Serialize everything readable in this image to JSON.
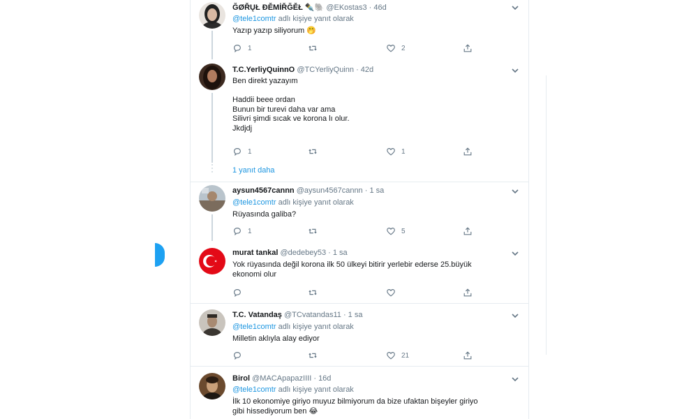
{
  "reply_to_label": "adlı kişiye yanıt olarak",
  "more_replies": "1 yanıt daha",
  "tweets": [
    {
      "name": "ĞØŘŲŁ ĐĚΜİŘĞĚŁ ✒️🐘",
      "handle": "@EKostas3",
      "time": "· 46d",
      "reply_to": "@tele1comtr",
      "text": [
        "Yazıp yazıp siliyorum 🤭"
      ],
      "reply_count": "1",
      "retweet_count": "",
      "like_count": "2"
    },
    {
      "name": "T.C.YerliyQuinnO",
      "handle": "@TCYerliyQuinn",
      "time": "· 42d",
      "reply_to": "",
      "text": [
        "Ben direkt yazayım",
        "",
        "Haddii beee ordan",
        "Bunun bir turevi daha var ama",
        "Silivri şimdi  sıcak  ve korona lı olur.",
        "Jkdjdj"
      ],
      "reply_count": "1",
      "retweet_count": "",
      "like_count": "1"
    },
    {
      "name": "aysun4567cannn",
      "handle": "@aysun4567cannn",
      "time": "· 1 sa",
      "reply_to": "@tele1comtr",
      "text": [
        "Rüyasında galiba?"
      ],
      "reply_count": "1",
      "retweet_count": "",
      "like_count": "5"
    },
    {
      "name": "murat tankal",
      "handle": "@dedebey53",
      "time": "· 1 sa",
      "reply_to": "",
      "text": [
        "Yok rüyasında değil korona ilk 50 ülkeyi bitirir yerlebir ederse 25.büyük",
        "ekonomi olur"
      ],
      "reply_count": "",
      "retweet_count": "",
      "like_count": ""
    },
    {
      "name": "T.C. Vatandaş",
      "handle": "@TCvatandas11",
      "time": "· 1 sa",
      "reply_to": "@tele1comtr",
      "text": [
        "Milletin aklıyla alay ediyor"
      ],
      "reply_count": "",
      "retweet_count": "",
      "like_count": "21"
    },
    {
      "name": "Birol",
      "handle": "@MACApapazIIII",
      "time": "· 16d",
      "reply_to": "@tele1comtr",
      "text": [
        "İlk 10 ekonomiye giriyo muyuz bilmiyorum da bize ufaktan bişeyler giriyo",
        "gibi hissediyorum ben 😂"
      ],
      "reply_count": "",
      "retweet_count": "",
      "like_count": ""
    }
  ],
  "colors": {
    "accent": "#1da1f2",
    "mention": "#1b95e0",
    "muted": "#657786",
    "border": "#e6ecf0"
  },
  "icons": {
    "reply": "reply-icon",
    "retweet": "retweet-icon",
    "like": "heart-icon",
    "share": "share-icon",
    "caret": "chevron-down-icon"
  }
}
